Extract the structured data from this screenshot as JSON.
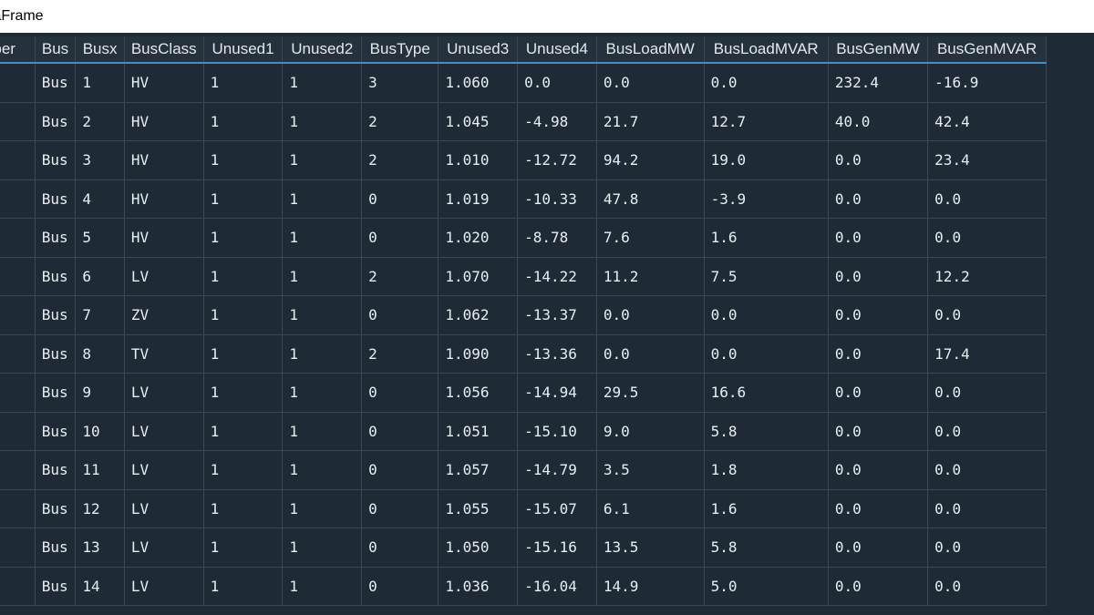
{
  "window": {
    "title": "taFrame"
  },
  "table": {
    "columns": [
      "umber",
      "Bus",
      "Busx",
      "BusClass",
      "Unused1",
      "Unused2",
      "BusType",
      "Unused3",
      "Unused4",
      "BusLoadMW",
      "BusLoadMVAR",
      "BusGenMW",
      "BusGenMVAR"
    ],
    "rows": [
      [
        "",
        "Bus",
        "1",
        "HV",
        "1",
        "1",
        "3",
        "1.060",
        "0.0",
        "0.0",
        "0.0",
        "232.4",
        "-16.9"
      ],
      [
        "",
        "Bus",
        "2",
        "HV",
        "1",
        "1",
        "2",
        "1.045",
        "-4.98",
        "21.7",
        "12.7",
        "40.0",
        "42.4"
      ],
      [
        "",
        "Bus",
        "3",
        "HV",
        "1",
        "1",
        "2",
        "1.010",
        "-12.72",
        "94.2",
        "19.0",
        "0.0",
        "23.4"
      ],
      [
        "",
        "Bus",
        "4",
        "HV",
        "1",
        "1",
        "0",
        "1.019",
        "-10.33",
        "47.8",
        "-3.9",
        "0.0",
        "0.0"
      ],
      [
        "",
        "Bus",
        "5",
        "HV",
        "1",
        "1",
        "0",
        "1.020",
        "-8.78",
        "7.6",
        "1.6",
        "0.0",
        "0.0"
      ],
      [
        "",
        "Bus",
        "6",
        "LV",
        "1",
        "1",
        "2",
        "1.070",
        "-14.22",
        "11.2",
        "7.5",
        "0.0",
        "12.2"
      ],
      [
        "",
        "Bus",
        "7",
        "ZV",
        "1",
        "1",
        "0",
        "1.062",
        "-13.37",
        "0.0",
        "0.0",
        "0.0",
        "0.0"
      ],
      [
        "",
        "Bus",
        "8",
        "TV",
        "1",
        "1",
        "2",
        "1.090",
        "-13.36",
        "0.0",
        "0.0",
        "0.0",
        "17.4"
      ],
      [
        "",
        "Bus",
        "9",
        "LV",
        "1",
        "1",
        "0",
        "1.056",
        "-14.94",
        "29.5",
        "16.6",
        "0.0",
        "0.0"
      ],
      [
        "",
        "Bus",
        "10",
        "LV",
        "1",
        "1",
        "0",
        "1.051",
        "-15.10",
        "9.0",
        "5.8",
        "0.0",
        "0.0"
      ],
      [
        "",
        "Bus",
        "11",
        "LV",
        "1",
        "1",
        "0",
        "1.057",
        "-14.79",
        "3.5",
        "1.8",
        "0.0",
        "0.0"
      ],
      [
        "",
        "Bus",
        "12",
        "LV",
        "1",
        "1",
        "0",
        "1.055",
        "-15.07",
        "6.1",
        "1.6",
        "0.0",
        "0.0"
      ],
      [
        "",
        "Bus",
        "13",
        "LV",
        "1",
        "1",
        "0",
        "1.050",
        "-15.16",
        "13.5",
        "5.8",
        "0.0",
        "0.0"
      ],
      [
        "",
        "Bus",
        "14",
        "LV",
        "1",
        "1",
        "0",
        "1.036",
        "-16.04",
        "14.9",
        "5.0",
        "0.0",
        "0.0"
      ]
    ]
  },
  "colors": {
    "background": "#1e2a35",
    "header_background": "#25313d",
    "header_underline": "#3f8ec9",
    "grid_line": "#3b4753",
    "text": "#e9eef3"
  }
}
